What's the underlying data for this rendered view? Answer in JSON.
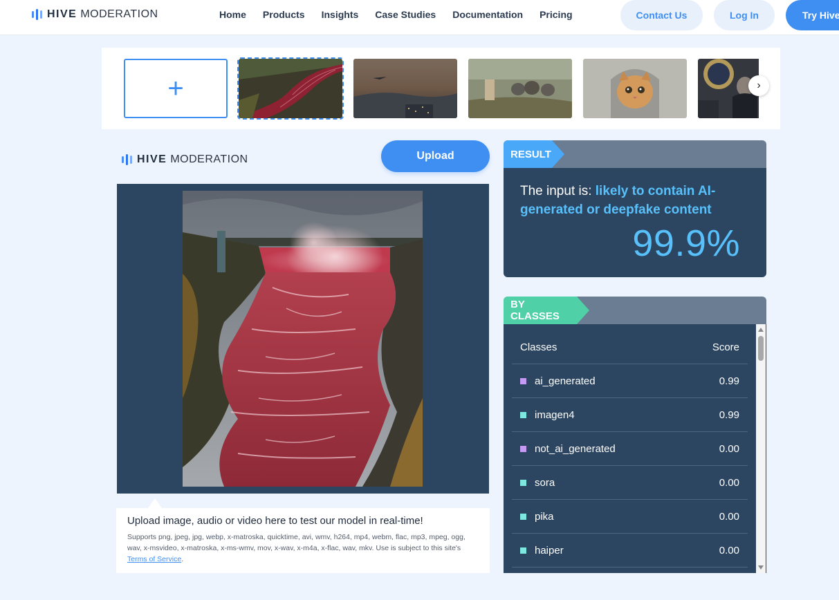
{
  "brand": {
    "bold": "HIVE",
    "light": "MODERATION"
  },
  "nav": {
    "links": [
      "Home",
      "Products",
      "Insights",
      "Case Studies",
      "Documentation",
      "Pricing"
    ],
    "contact": "Contact Us",
    "login": "Log In",
    "try": "Try Hive"
  },
  "strip": {
    "add_symbol": "+",
    "items": [
      "red-river-waterfall",
      "dusk-city-ufo",
      "painter-elephants",
      "cat-in-hoodie",
      "press-podium"
    ],
    "selected_index": 0,
    "next_symbol": "›"
  },
  "panel": {
    "upload": "Upload",
    "caption_title": "Upload image, audio or video here to test our model in real-time!",
    "caption_text": "Supports png, jpeg, jpg, webp, x-matroska, quicktime, avi, wmv, h264, mp4, webm, flac, mp3, mpeg, ogg, wav, x-msvideo, x-matroska, x-ms-wmv, mov, x-wav, x-m4a, x-flac, wav, mkv. Use is subject to this site's ",
    "terms_link": "Terms of Service",
    "caption_end": "."
  },
  "result": {
    "label": "RESULT",
    "prefix": "The input is: ",
    "verdict": "likely to contain AI-generated or deepfake content",
    "percent": "99.9%"
  },
  "classes": {
    "label": "BY CLASSES",
    "col_class": "Classes",
    "col_score": "Score",
    "rows": [
      {
        "name": "ai_generated",
        "score": "0.99",
        "color": "#c59af4"
      },
      {
        "name": "imagen4",
        "score": "0.99",
        "color": "#7ee8e0"
      },
      {
        "name": "not_ai_generated",
        "score": "0.00",
        "color": "#c59af4"
      },
      {
        "name": "sora",
        "score": "0.00",
        "color": "#7ee8e0"
      },
      {
        "name": "pika",
        "score": "0.00",
        "color": "#7ee8e0"
      },
      {
        "name": "haiper",
        "score": "0.00",
        "color": "#7ee8e0"
      }
    ]
  },
  "colors": {
    "accent": "#3f8ff3",
    "result_tag": "#49a9f8",
    "classes_tag": "#4fd0a7",
    "card_bg": "#2c4560",
    "highlight": "#58c0fb"
  }
}
